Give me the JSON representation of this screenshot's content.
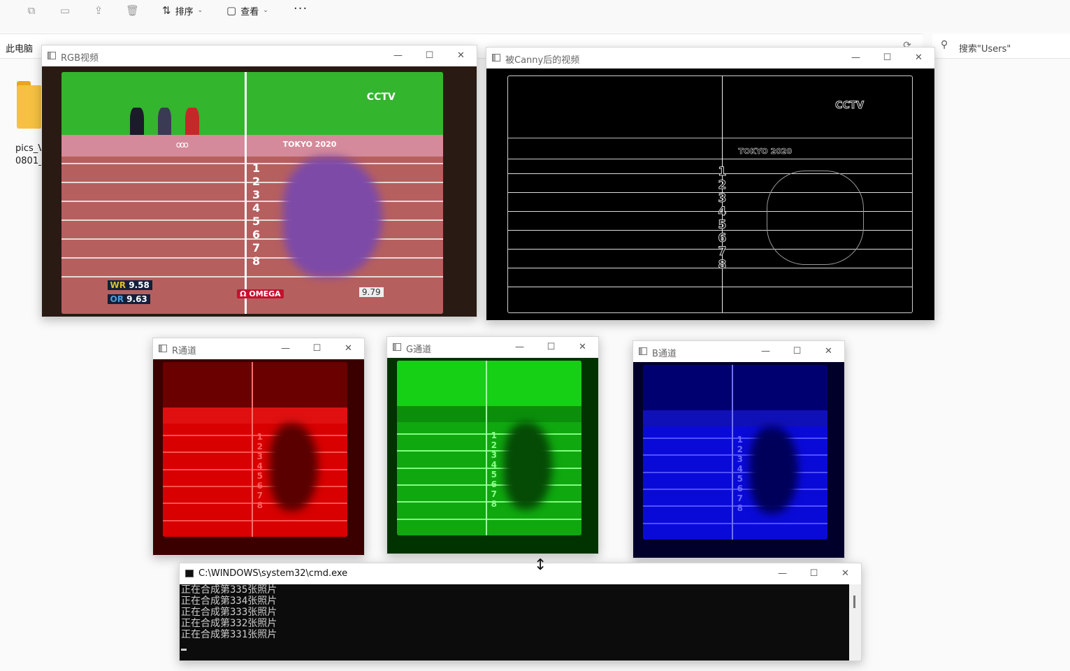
{
  "explorer": {
    "toolbar": {
      "sort_label": "排序",
      "view_label": "查看",
      "more": "···"
    },
    "address": {
      "crumb": "此电脑",
      "refresh_icon": "refresh-icon"
    },
    "search": {
      "placeholder": "搜索\"Users\""
    },
    "folder": {
      "label": "pics_V",
      "label2": "0801_"
    }
  },
  "windows": {
    "rgb": {
      "title": "RGB视频"
    },
    "canny": {
      "title": "被Canny后的视频"
    },
    "r": {
      "title": "R通道"
    },
    "g": {
      "title": "G通道"
    },
    "b": {
      "title": "B通道"
    },
    "cmd": {
      "title": "C:\\WINDOWS\\system32\\cmd.exe"
    }
  },
  "video": {
    "lane_numbers": [
      "1",
      "2",
      "3",
      "4",
      "5",
      "6",
      "7",
      "8"
    ],
    "wr_label": "WR",
    "wr_time": "9.58",
    "or_label": "OR",
    "or_time": "9.63",
    "brand": "CCTV",
    "event": "TOKYO 2020",
    "sponsor": "Ω OMEGA",
    "timer": "9.79",
    "rings": "ooo"
  },
  "cmd_output": [
    "正在合成第335张照片",
    "正在合成第334张照片",
    "正在合成第333张照片",
    "正在合成第332张照片",
    "正在合成第331张照片"
  ],
  "controls": {
    "minimize": "—",
    "maximize": "☐",
    "close": "✕"
  }
}
